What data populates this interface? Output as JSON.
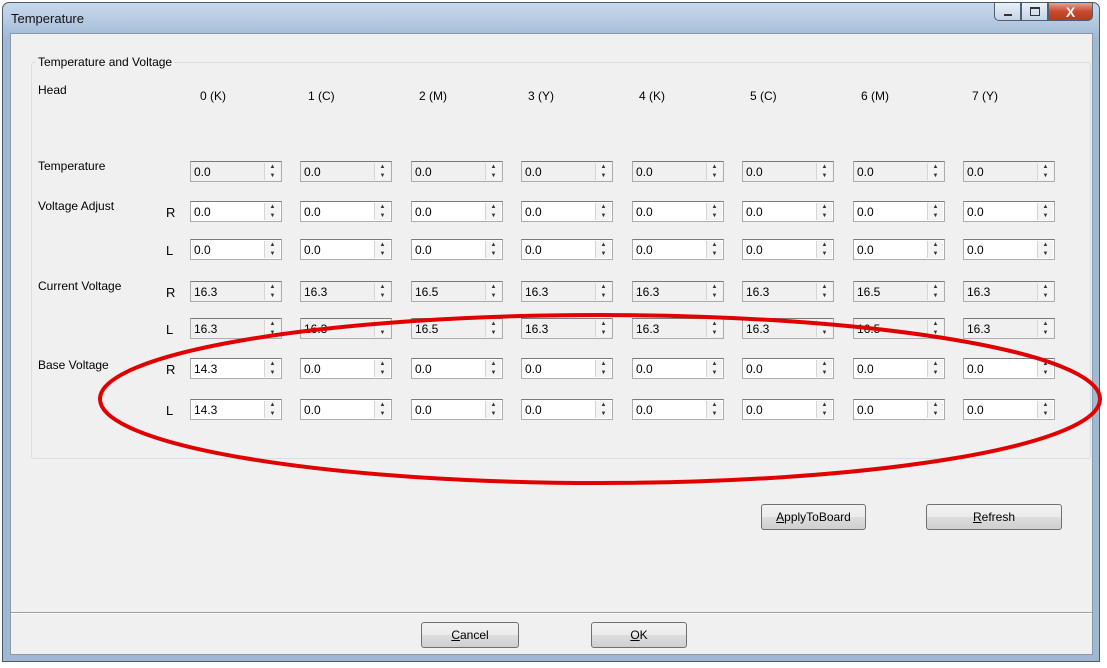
{
  "window": {
    "title": "Temperature",
    "controls": {
      "minimize": "–",
      "maximize": "□",
      "close": "X"
    }
  },
  "group": {
    "title": "Temperature and Voltage",
    "head_label": "Head",
    "heads": [
      "0  (K)",
      "1  (C)",
      "2  (M)",
      "3  (Y)",
      "4  (K)",
      "5  (C)",
      "6  (M)",
      "7  (Y)"
    ]
  },
  "rows": [
    {
      "label": "Temperature",
      "side": "",
      "readonly": true,
      "values": [
        "0.0",
        "0.0",
        "0.0",
        "0.0",
        "0.0",
        "0.0",
        "0.0",
        "0.0"
      ]
    },
    {
      "label": "Voltage Adjust",
      "side": "R",
      "readonly": false,
      "values": [
        "0.0",
        "0.0",
        "0.0",
        "0.0",
        "0.0",
        "0.0",
        "0.0",
        "0.0"
      ]
    },
    {
      "label": "",
      "side": "L",
      "readonly": false,
      "values": [
        "0.0",
        "0.0",
        "0.0",
        "0.0",
        "0.0",
        "0.0",
        "0.0",
        "0.0"
      ]
    },
    {
      "label": "Current Voltage",
      "side": "R",
      "readonly": true,
      "values": [
        "16.3",
        "16.3",
        "16.5",
        "16.3",
        "16.3",
        "16.3",
        "16.5",
        "16.3"
      ]
    },
    {
      "label": "",
      "side": "L",
      "readonly": true,
      "values": [
        "16.3",
        "16.3",
        "16.5",
        "16.3",
        "16.3",
        "16.3",
        "16.5",
        "16.3"
      ]
    },
    {
      "label": "Base Voltage",
      "side": "R",
      "readonly": false,
      "values": [
        "14.3",
        "0.0",
        "0.0",
        "0.0",
        "0.0",
        "0.0",
        "0.0",
        "0.0"
      ]
    },
    {
      "label": "",
      "side": "L",
      "readonly": false,
      "values": [
        "14.3",
        "0.0",
        "0.0",
        "0.0",
        "0.0",
        "0.0",
        "0.0",
        "0.0"
      ]
    }
  ],
  "buttons": {
    "apply": {
      "mnemonic": "A",
      "rest": "pplyToBoard"
    },
    "refresh": {
      "mnemonic": "R",
      "rest": "efresh"
    },
    "cancel": {
      "mnemonic": "C",
      "rest": "ancel"
    },
    "ok": {
      "mnemonic": "O",
      "rest": "K"
    }
  },
  "annotation": {
    "color": "#e00000"
  }
}
